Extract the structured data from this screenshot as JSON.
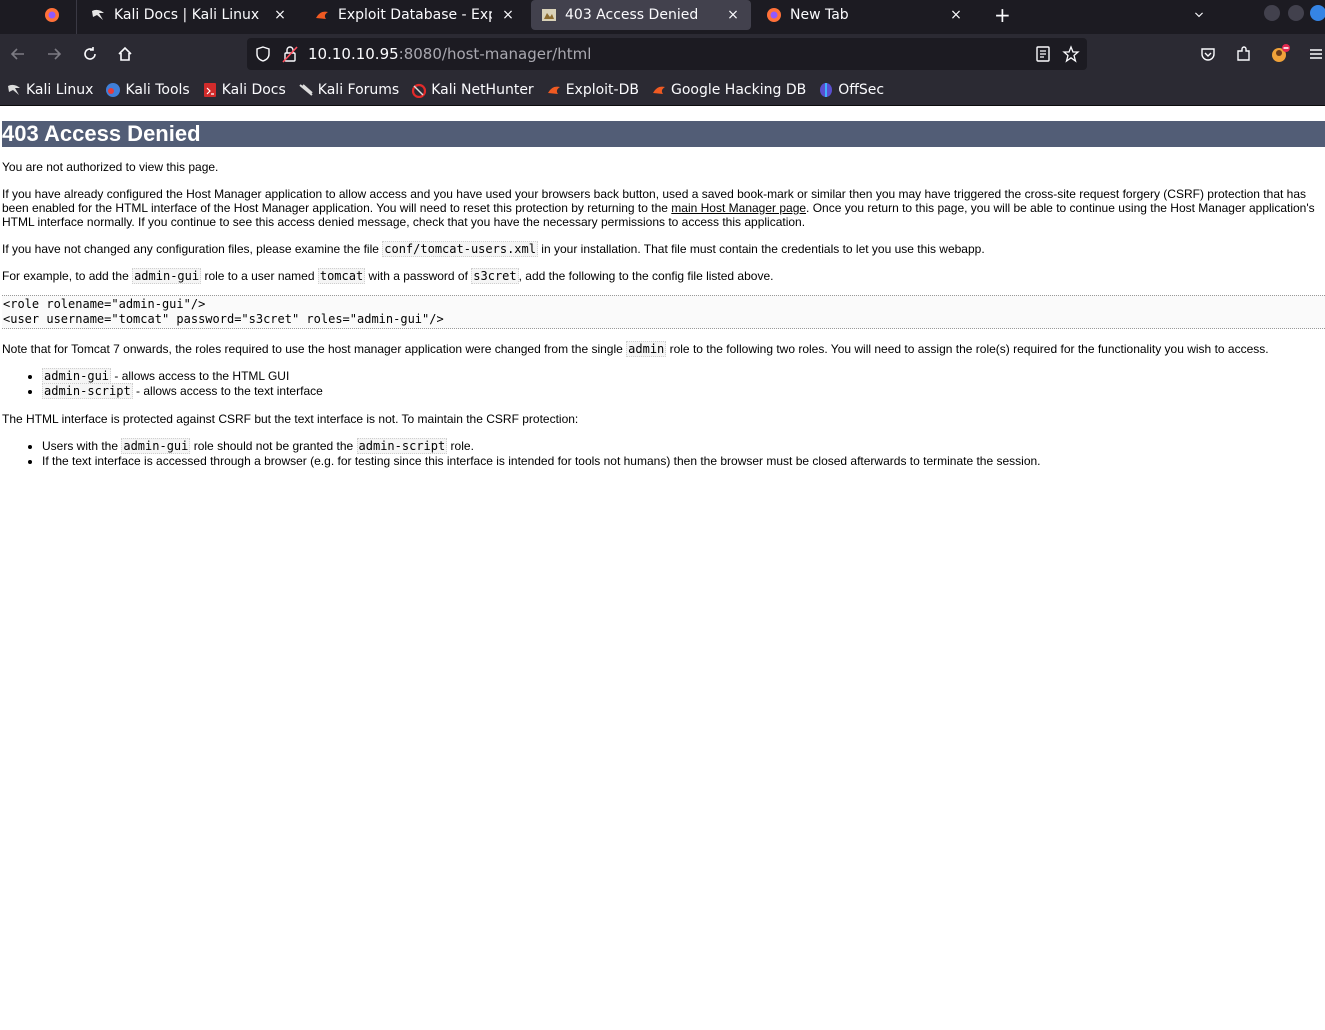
{
  "browser": {
    "tabs": [
      {
        "title": "Kali Docs | Kali Linux Docu",
        "icon": "kali-dragon-icon"
      },
      {
        "title": "Exploit Database - Exploit",
        "icon": "exploit-db-icon"
      },
      {
        "title": "403 Access Denied",
        "icon": "tomcat-icon",
        "active": true
      },
      {
        "title": "New Tab",
        "icon": "firefox-icon"
      }
    ],
    "new_tab_symbol": "+",
    "tab_close_symbol": "×",
    "url_host": "10.10.10.95",
    "url_rest": ":8080/host-manager/html",
    "bookmarks": [
      {
        "label": "Kali Linux"
      },
      {
        "label": "Kali Tools"
      },
      {
        "label": "Kali Docs"
      },
      {
        "label": "Kali Forums"
      },
      {
        "label": "Kali NetHunter"
      },
      {
        "label": "Exploit-DB"
      },
      {
        "label": "Google Hacking DB"
      },
      {
        "label": "OffSec"
      }
    ]
  },
  "page": {
    "heading": "403 Access Denied",
    "p1": "You are not authorized to view this page.",
    "p2_a": "If you have already configured the Host Manager application to allow access and you have used your browsers back button, used a saved book-mark or similar then you may have triggered the cross-site request forgery (CSRF) protection that has been enabled for the HTML interface of the Host Manager application. You will need to reset this protection by returning to the ",
    "p2_link": "main Host Manager page",
    "p2_b": ". Once you return to this page, you will be able to continue using the Host Manager application's HTML interface normally. If you continue to see this access denied message, check that you have the necessary permissions to access this application.",
    "p3_a": "If you have not changed any configuration files, please examine the file ",
    "p3_code": "conf/tomcat-users.xml",
    "p3_b": " in your installation. That file must contain the credentials to let you use this webapp.",
    "p4_a": "For example, to add the ",
    "p4_code1": "admin-gui",
    "p4_b": " role to a user named ",
    "p4_code2": "tomcat",
    "p4_c": " with a password of ",
    "p4_code3": "s3cret",
    "p4_d": ", add the following to the config file listed above.",
    "pre_line1": "<role rolename=\"admin-gui\"/>",
    "pre_line2": "<user username=\"tomcat\" password=\"s3cret\" roles=\"admin-gui\"/>",
    "p5_a": "Note that for Tomcat 7 onwards, the roles required to use the host manager application were changed from the single ",
    "p5_code": "admin",
    "p5_b": " role to the following two roles. You will need to assign the role(s) required for the functionality you wish to access.",
    "roles": [
      {
        "code": "admin-gui",
        "text": " - allows access to the HTML GUI"
      },
      {
        "code": "admin-script",
        "text": " - allows access to the text interface"
      }
    ],
    "p6": "The HTML interface is protected against CSRF but the text interface is not. To maintain the CSRF protection:",
    "csrf_1_a": "Users with the ",
    "csrf_1_code1": "admin-gui",
    "csrf_1_b": " role should not be granted the ",
    "csrf_1_code2": "admin-script",
    "csrf_1_c": " role.",
    "csrf_2": "If the text interface is accessed through a browser (e.g. for testing since this interface is intended for tools not humans) then the browser must be closed afterwards to terminate the session."
  }
}
